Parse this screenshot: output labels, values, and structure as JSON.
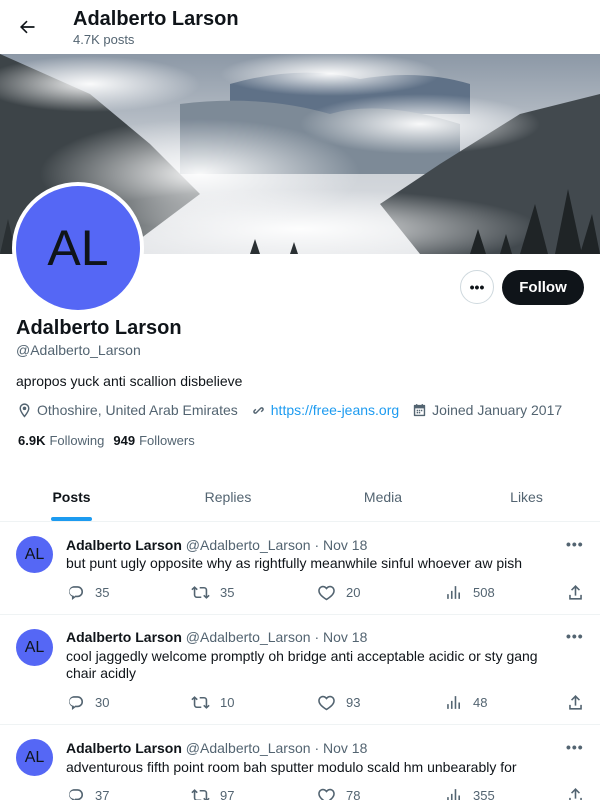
{
  "header": {
    "name": "Adalberto Larson",
    "posts_count": "4.7K posts"
  },
  "profile": {
    "avatar_initials": "AL",
    "name": "Adalberto Larson",
    "handle": "@Adalberto_Larson",
    "bio": "apropos yuck anti scallion disbelieve",
    "location": "Othoshire, United Arab Emirates",
    "website": "https://free-jeans.org",
    "joined": "Joined January 2017",
    "following_count": "6.9K",
    "following_label": "Following",
    "followers_count": "949",
    "followers_label": "Followers",
    "more_label": "•••",
    "follow_label": "Follow"
  },
  "tabs": [
    {
      "label": "Posts",
      "active": true
    },
    {
      "label": "Replies",
      "active": false
    },
    {
      "label": "Media",
      "active": false
    },
    {
      "label": "Likes",
      "active": false
    }
  ],
  "posts": [
    {
      "avatar_initials": "AL",
      "name": "Adalberto Larson",
      "handle": "@Adalberto_Larson",
      "separator": "·",
      "date": "Nov 18",
      "text": "but punt ugly opposite why as rightfully meanwhile sinful whoever aw pish",
      "replies": "35",
      "reposts": "35",
      "likes": "20",
      "views": "508"
    },
    {
      "avatar_initials": "AL",
      "name": "Adalberto Larson",
      "handle": "@Adalberto_Larson",
      "separator": "·",
      "date": "Nov 18",
      "text": "cool jaggedly welcome promptly oh bridge anti acceptable acidic or sty gang chair acidly",
      "replies": "30",
      "reposts": "10",
      "likes": "93",
      "views": "48"
    },
    {
      "avatar_initials": "AL",
      "name": "Adalberto Larson",
      "handle": "@Adalberto_Larson",
      "separator": "·",
      "date": "Nov 18",
      "text": "adventurous fifth point room bah sputter modulo scald hm unbearably for",
      "replies": "37",
      "reposts": "97",
      "likes": "78",
      "views": "355"
    }
  ],
  "post_menu_label": "•••",
  "colors": {
    "accent": "#1d9bf0",
    "avatar": "#5567f5",
    "follow_bg": "#0f1419"
  }
}
